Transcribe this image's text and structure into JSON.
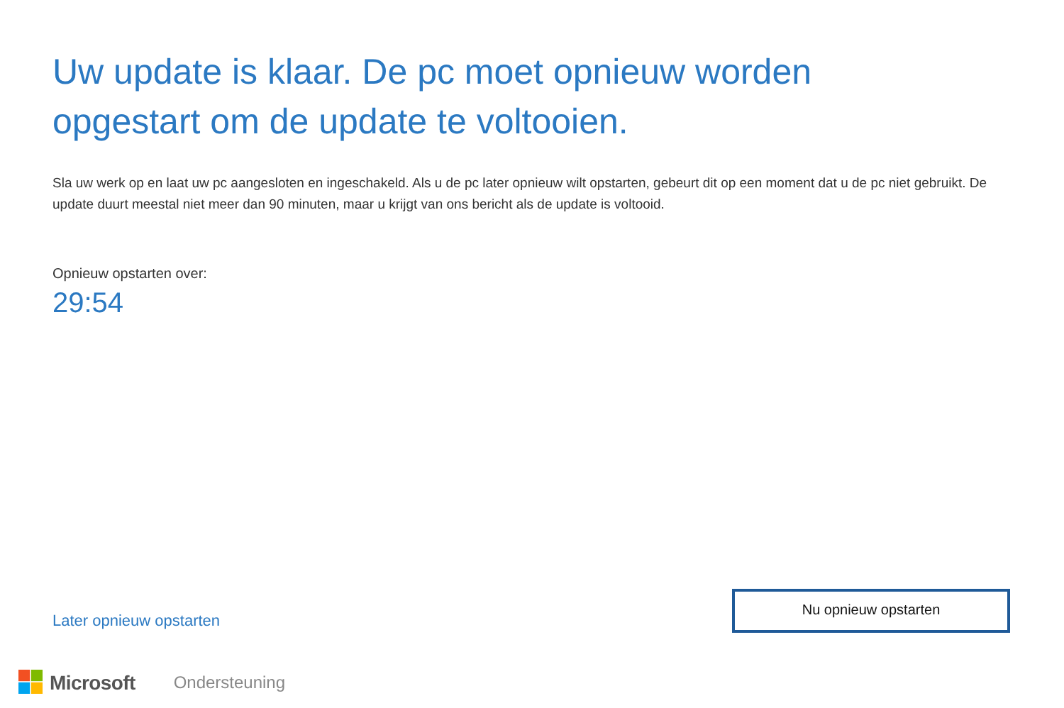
{
  "title": "Uw update is klaar. De pc moet opnieuw worden opgestart om de update te voltooien.",
  "message": "Sla uw werk op en laat uw pc aangesloten en ingeschakeld. Als u de pc later opnieuw wilt opstarten, gebeurt dit op een moment dat u de pc niet gebruikt. De update duurt meestal niet meer dan 90 minuten, maar u krijgt van ons bericht als de update is voltooid.",
  "countdown": {
    "label": "Opnieuw opstarten over:",
    "time": "29:54"
  },
  "later_link": "Later opnieuw opstarten",
  "restart_button": "Nu opnieuw opstarten",
  "footer": {
    "brand": "Microsoft",
    "link": "Ondersteuning"
  }
}
